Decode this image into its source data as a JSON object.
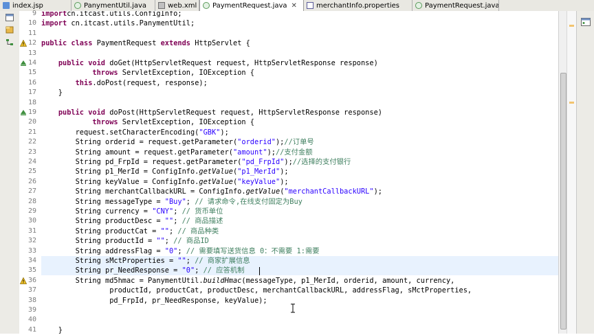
{
  "tabs": [
    {
      "label": "index.jsp",
      "icon": "jsp-file-icon",
      "active": false
    },
    {
      "label": "PanymentUtil.java",
      "icon": "java-file-icon",
      "active": false
    },
    {
      "label": "web.xml",
      "icon": "xml-file-icon",
      "active": false
    },
    {
      "label": "PaymentRequest.java",
      "icon": "java-file-icon",
      "active": true,
      "close": "✕"
    },
    {
      "label": "merchantInfo.properties",
      "icon": "properties-file-icon",
      "active": false
    },
    {
      "label": "PaymentRequest.java",
      "icon": "java-file-icon",
      "active": false
    }
  ],
  "editor": {
    "lines": [
      {
        "num": "9",
        "parts": [
          [
            "kw",
            "import"
          ],
          [
            "",
            "cn.itcast.utils.ConfigInfo;"
          ]
        ]
      },
      {
        "num": "10",
        "parts": [
          [
            "kw",
            "import"
          ],
          [
            "",
            " cn.itcast.utils.PanymentUtil;"
          ]
        ]
      },
      {
        "num": "11",
        "parts": []
      },
      {
        "num": "12",
        "marker": "warning",
        "parts": [
          [
            "kw",
            "public class"
          ],
          [
            "",
            " PaymentRequest "
          ],
          [
            "kw",
            "extends"
          ],
          [
            "",
            " HttpServlet {"
          ]
        ]
      },
      {
        "num": "13",
        "parts": []
      },
      {
        "num": "14",
        "marker": "override",
        "parts": [
          [
            "",
            "    "
          ],
          [
            "kw",
            "public void"
          ],
          [
            "",
            " doGet(HttpServletRequest request, HttpServletResponse response)"
          ]
        ]
      },
      {
        "num": "15",
        "parts": [
          [
            "",
            "            "
          ],
          [
            "kw",
            "throws"
          ],
          [
            "",
            " ServletException, IOException {"
          ]
        ]
      },
      {
        "num": "16",
        "parts": [
          [
            "",
            "        "
          ],
          [
            "kw",
            "this"
          ],
          [
            "",
            ".doPost(request, response);"
          ]
        ]
      },
      {
        "num": "17",
        "parts": [
          [
            "",
            "    }"
          ]
        ]
      },
      {
        "num": "18",
        "parts": []
      },
      {
        "num": "19",
        "marker": "override",
        "parts": [
          [
            "",
            "    "
          ],
          [
            "kw",
            "public void"
          ],
          [
            "",
            " doPost(HttpServletRequest request, HttpServletResponse response)"
          ]
        ]
      },
      {
        "num": "20",
        "parts": [
          [
            "",
            "            "
          ],
          [
            "kw",
            "throws"
          ],
          [
            "",
            " ServletException, IOException {"
          ]
        ]
      },
      {
        "num": "21",
        "parts": [
          [
            "",
            "        request.setCharacterEncoding("
          ],
          [
            "str",
            "\"GBK\""
          ],
          [
            "",
            ");"
          ]
        ]
      },
      {
        "num": "22",
        "parts": [
          [
            "",
            "        String orderid = request.getParameter("
          ],
          [
            "str",
            "\"orderid\""
          ],
          [
            "",
            ");"
          ],
          [
            "cm",
            "//订单号"
          ]
        ]
      },
      {
        "num": "23",
        "parts": [
          [
            "",
            "        String amount = request.getParameter("
          ],
          [
            "str",
            "\"amount\""
          ],
          [
            "",
            ");"
          ],
          [
            "cm",
            "//支付金额"
          ]
        ]
      },
      {
        "num": "24",
        "parts": [
          [
            "",
            "        String pd_FrpId = request.getParameter("
          ],
          [
            "str",
            "\"pd_FrpId\""
          ],
          [
            "",
            ");"
          ],
          [
            "cm",
            "//选择的支付银行"
          ]
        ]
      },
      {
        "num": "25",
        "parts": [
          [
            "",
            "        String p1_MerId = ConfigInfo."
          ],
          [
            "it",
            "getValue"
          ],
          [
            "",
            "("
          ],
          [
            "str",
            "\"p1_MerId\""
          ],
          [
            "",
            ");"
          ]
        ]
      },
      {
        "num": "26",
        "parts": [
          [
            "",
            "        String keyValue = ConfigInfo."
          ],
          [
            "it",
            "getValue"
          ],
          [
            "",
            "("
          ],
          [
            "str",
            "\"keyValue\""
          ],
          [
            "",
            ");"
          ]
        ]
      },
      {
        "num": "27",
        "parts": [
          [
            "",
            "        String merchantCallbackURL = ConfigInfo."
          ],
          [
            "it",
            "getValue"
          ],
          [
            "",
            "("
          ],
          [
            "str",
            "\"merchantCallbackURL\""
          ],
          [
            "",
            ");"
          ]
        ]
      },
      {
        "num": "28",
        "parts": [
          [
            "",
            "        String messageType = "
          ],
          [
            "str",
            "\"Buy\""
          ],
          [
            "",
            "; "
          ],
          [
            "cm",
            "// 请求命令,在线支付固定为Buy"
          ]
        ]
      },
      {
        "num": "29",
        "parts": [
          [
            "",
            "        String currency = "
          ],
          [
            "str",
            "\"CNY\""
          ],
          [
            "",
            "; "
          ],
          [
            "cm",
            "// 货币单位"
          ]
        ]
      },
      {
        "num": "30",
        "parts": [
          [
            "",
            "        String productDesc = "
          ],
          [
            "str",
            "\"\""
          ],
          [
            "",
            "; "
          ],
          [
            "cm",
            "// 商品描述"
          ]
        ]
      },
      {
        "num": "31",
        "parts": [
          [
            "",
            "        String productCat = "
          ],
          [
            "str",
            "\"\""
          ],
          [
            "",
            "; "
          ],
          [
            "cm",
            "// 商品种类"
          ]
        ]
      },
      {
        "num": "32",
        "parts": [
          [
            "",
            "        String productId = "
          ],
          [
            "str",
            "\"\""
          ],
          [
            "",
            "; "
          ],
          [
            "cm",
            "// 商品ID"
          ]
        ]
      },
      {
        "num": "33",
        "parts": [
          [
            "",
            "        String addressFlag = "
          ],
          [
            "str",
            "\"0\""
          ],
          [
            "",
            "; "
          ],
          [
            "cm",
            "// 需要填写送货信息 0：不需要 1:需要"
          ]
        ]
      },
      {
        "num": "34",
        "highlight": true,
        "parts": [
          [
            "",
            "        String sMctProperties = "
          ],
          [
            "str",
            "\"\""
          ],
          [
            "",
            "; "
          ],
          [
            "cm",
            "// 商家扩展信息"
          ]
        ]
      },
      {
        "num": "35",
        "highlight": true,
        "parts": [
          [
            "",
            "        String pr_NeedResponse = "
          ],
          [
            "str",
            "\"0\""
          ],
          [
            "",
            "; "
          ],
          [
            "cm",
            "// 应答机制"
          ]
        ]
      },
      {
        "num": "36",
        "marker": "warning",
        "parts": [
          [
            "",
            "        String md5hmac = PanymentUtil."
          ],
          [
            "it",
            "buildHmac"
          ],
          [
            "",
            "(messageType, p1_MerId, orderid, amount, currency,"
          ]
        ]
      },
      {
        "num": "37",
        "parts": [
          [
            "",
            "                productId, productCat, productDesc, merchantCallbackURL, addressFlag, sMctProperties,"
          ]
        ]
      },
      {
        "num": "38",
        "parts": [
          [
            "",
            "                pd_FrpId, pr_NeedResponse, keyValue);"
          ]
        ]
      },
      {
        "num": "39",
        "parts": []
      },
      {
        "num": "40",
        "parts": []
      },
      {
        "num": "41",
        "parts": [
          [
            "",
            "    }"
          ]
        ]
      }
    ]
  }
}
